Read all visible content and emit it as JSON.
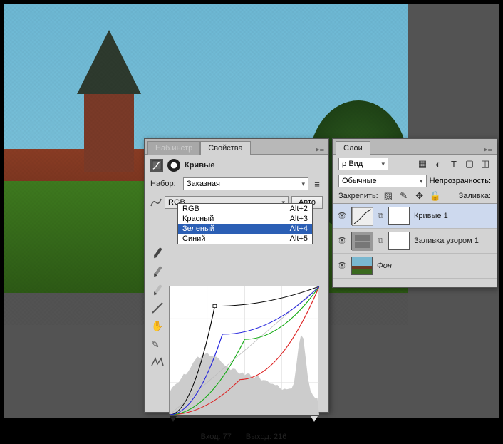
{
  "properties_panel": {
    "tabs": {
      "tools": "Наб.инстр",
      "properties": "Свойства"
    },
    "title": "Кривые",
    "preset_label": "Набор:",
    "preset_value": "Заказная",
    "channel_value": "RGB",
    "auto_label": "Авто",
    "channel_options": [
      {
        "label": "RGB",
        "shortcut": "Alt+2"
      },
      {
        "label": "Красный",
        "shortcut": "Alt+3"
      },
      {
        "label": "Зеленый",
        "shortcut": "Alt+4"
      },
      {
        "label": "Синий",
        "shortcut": "Alt+5"
      }
    ],
    "input_label": "Вход:",
    "input_value": "77",
    "output_label": "Выход:",
    "output_value": "216"
  },
  "layers_panel": {
    "tab": "Слои",
    "filter_label": "Вид",
    "blend_mode": "Обычные",
    "opacity_label": "Непрозрачность:",
    "lock_label": "Закрепить:",
    "fill_label": "Заливка:",
    "layers": [
      {
        "name": "Кривые 1"
      },
      {
        "name": "Заливка узором 1"
      },
      {
        "name": "Фон"
      }
    ]
  },
  "chart_data": {
    "type": "line",
    "title": "Кривые",
    "xlabel": "Вход",
    "ylabel": "Выход",
    "xlim": [
      0,
      255
    ],
    "ylim": [
      0,
      255
    ],
    "series": [
      {
        "name": "RGB",
        "color": "#000000",
        "points": [
          [
            0,
            0
          ],
          [
            77,
            216
          ],
          [
            255,
            255
          ]
        ]
      },
      {
        "name": "Красный",
        "color": "#d22",
        "points": [
          [
            0,
            0
          ],
          [
            120,
            70
          ],
          [
            255,
            255
          ]
        ]
      },
      {
        "name": "Зеленый",
        "color": "#1a1",
        "points": [
          [
            0,
            0
          ],
          [
            128,
            150
          ],
          [
            255,
            255
          ]
        ]
      },
      {
        "name": "Синий",
        "color": "#22d",
        "points": [
          [
            0,
            0
          ],
          [
            90,
            160
          ],
          [
            255,
            255
          ]
        ]
      }
    ],
    "selected_point": {
      "input": 77,
      "output": 216
    }
  }
}
